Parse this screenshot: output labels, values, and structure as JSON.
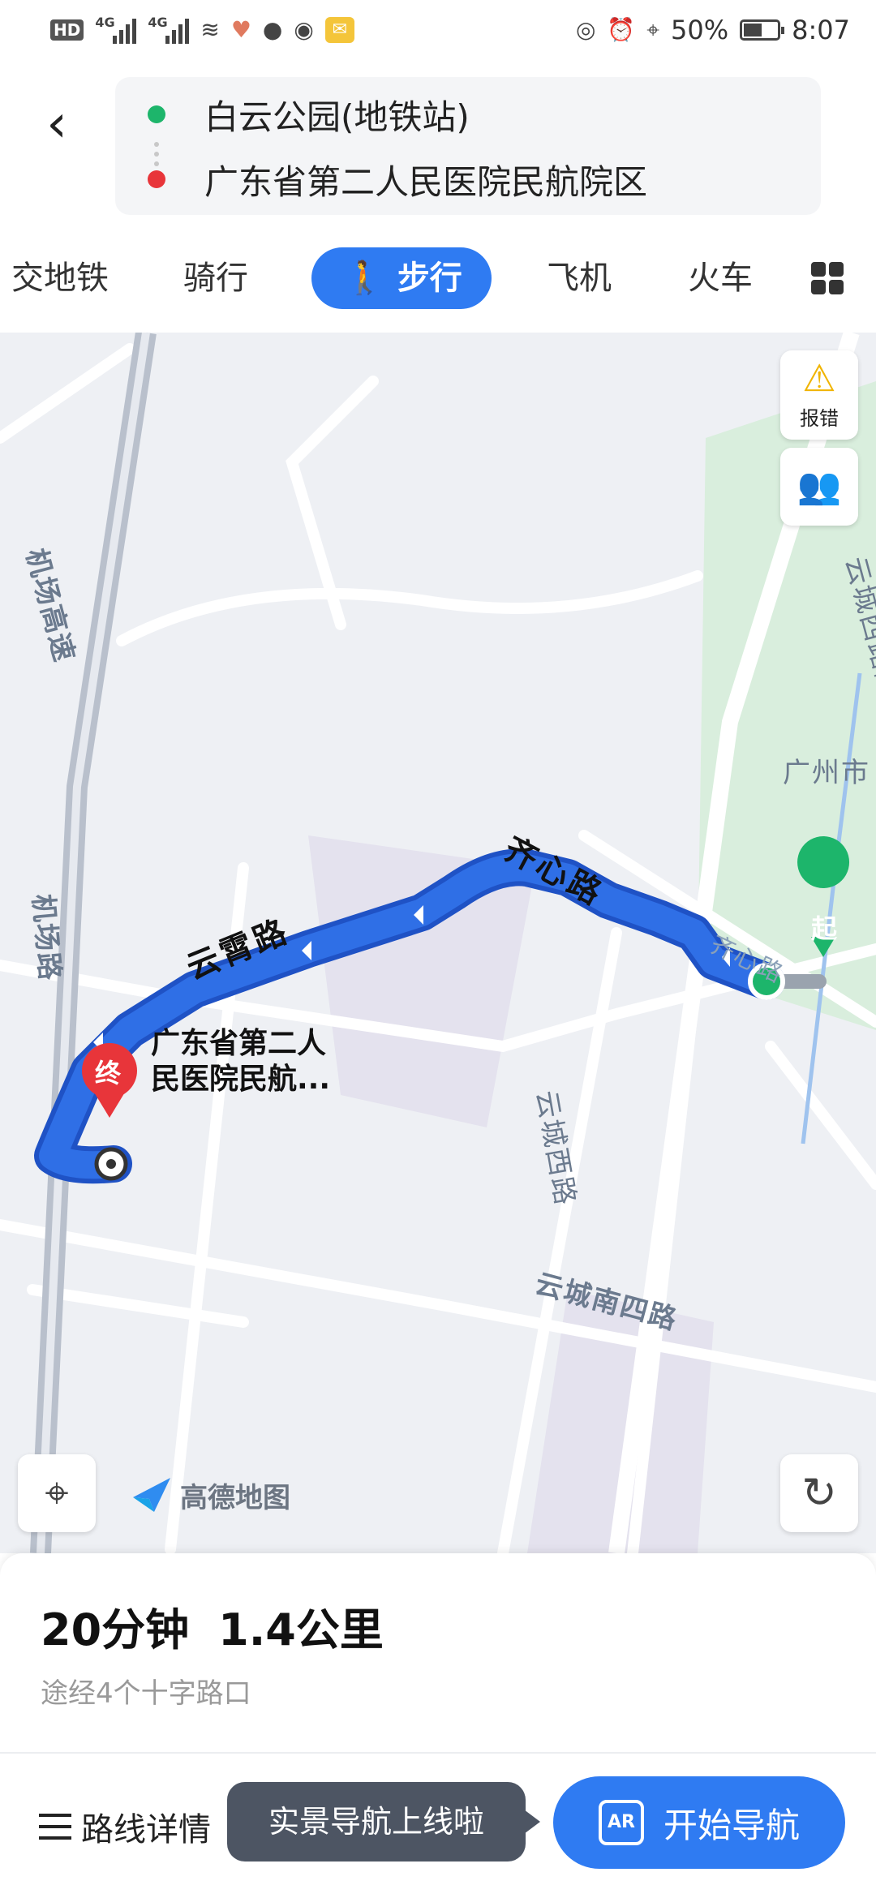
{
  "status_bar": {
    "hd_label": "HD",
    "network_1": "4G",
    "network_2": "4G",
    "battery": "50%",
    "time": "8:07",
    "icons": [
      "hd-icon",
      "signal-icon",
      "signal-icon",
      "wifi-icon",
      "health-icon",
      "wechat-icon",
      "pet-icon",
      "mail-icon",
      "eye-icon",
      "alarm-icon",
      "location-icon",
      "battery-icon"
    ]
  },
  "route": {
    "start": "白云公园(地铁站)",
    "end": "广东省第二人民医院民航院区",
    "back_icon": "back-arrow-icon",
    "swap_icon": "swap-icon"
  },
  "tabs": [
    {
      "label": "交地铁",
      "active": false
    },
    {
      "label": "骑行",
      "active": false
    },
    {
      "label": "步行",
      "active": true,
      "icon": "walk-icon"
    },
    {
      "label": "飞机",
      "active": false
    },
    {
      "label": "火车",
      "active": false
    }
  ],
  "map": {
    "roads": {
      "airport_expressway": "机场高速",
      "airport_road": "机场路",
      "yuncheng_west_tunnel": "云城西路隧道",
      "guangzhou_city": "广州市",
      "yuncheng_west": "云城西路",
      "yuncheng_south4": "云城南四路",
      "qixin_small": "齐心路"
    },
    "route_labels": {
      "qixin": "齐心路",
      "yunxiao": "云霄路"
    },
    "start_marker": "起",
    "end_marker": "终",
    "destination_label": "广东省第二人民医院民航...",
    "report_label": "报错",
    "logo_text": "高德地图",
    "route_color": "#2f6fe6",
    "park_color": "#d9eedd"
  },
  "info": {
    "duration": "20分钟",
    "distance": "1.4公里",
    "via": "途经4个十字路口"
  },
  "actions": {
    "details": "路线详情",
    "tooltip": "实景导航上线啦",
    "start": "开始导航",
    "ar_label": "AR",
    "accent": "#2f7bf2"
  }
}
